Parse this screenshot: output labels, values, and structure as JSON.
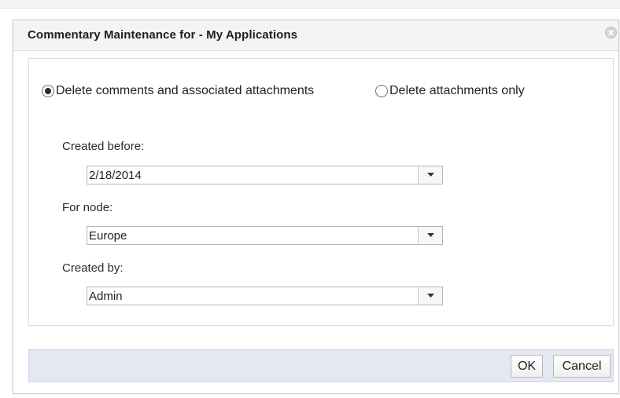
{
  "dialog": {
    "title": "Commentary Maintenance for - My Applications"
  },
  "options": {
    "delete_all_label": "Delete comments and associated attachments",
    "delete_attachments_label": "Delete attachments only",
    "selected": "delete_all"
  },
  "fields": {
    "created_before": {
      "label": "Created before:",
      "value": "2/18/2014"
    },
    "for_node": {
      "label": "For node:",
      "value": "Europe"
    },
    "created_by": {
      "label": "Created by:",
      "value": "Admin"
    }
  },
  "buttons": {
    "ok_label": "OK",
    "cancel_label": "Cancel"
  }
}
